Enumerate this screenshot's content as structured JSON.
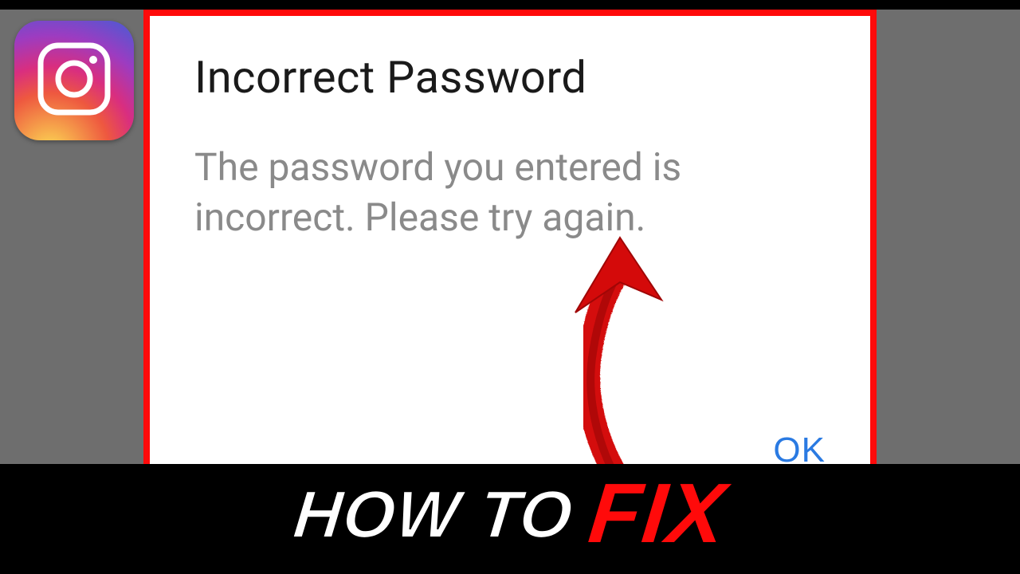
{
  "brand": {
    "name": "instagram"
  },
  "dialog": {
    "title": "Incorrect Password",
    "body": "The password you entered is incorrect. Please try again.",
    "ok_label": "OK"
  },
  "banner": {
    "lead": "HOW TO",
    "emphasis": "FIX"
  },
  "colors": {
    "accent_red": "#ff0a0a",
    "link_blue": "#2a7ae2",
    "bg_grey": "#6e6e6e"
  }
}
